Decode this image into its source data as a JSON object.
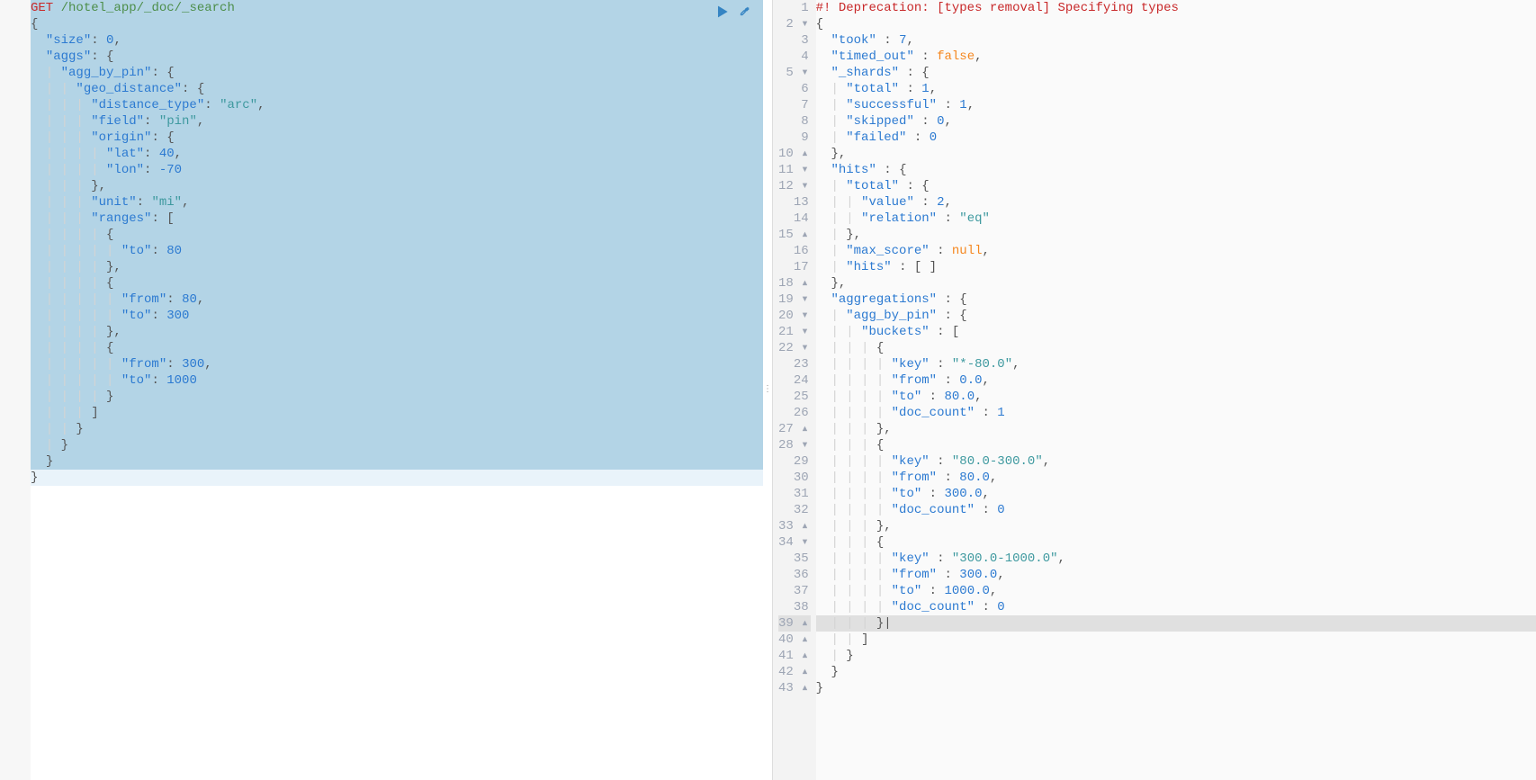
{
  "request": {
    "method": "GET",
    "path": "/hotel_app/_doc/_search",
    "body": {
      "size": 0,
      "aggs": {
        "agg_by_pin": {
          "geo_distance": {
            "distance_type": "arc",
            "field": "pin",
            "origin": {
              "lat": 40,
              "lon": -70
            },
            "unit": "mi",
            "ranges": [
              {
                "to": 80
              },
              {
                "from": 80,
                "to": 300
              },
              {
                "from": 300,
                "to": 1000
              }
            ]
          }
        }
      }
    }
  },
  "response": {
    "warning": "#! Deprecation: [types removal] Specifying types",
    "body": {
      "took": 7,
      "timed_out": false,
      "_shards": {
        "total": 1,
        "successful": 1,
        "skipped": 0,
        "failed": 0
      },
      "hits": {
        "total": {
          "value": 2,
          "relation": "eq"
        },
        "max_score": null,
        "hits": []
      },
      "aggregations": {
        "agg_by_pin": {
          "buckets": [
            {
              "key": "*-80.0",
              "from": 0.0,
              "to": 80.0,
              "doc_count": 1
            },
            {
              "key": "80.0-300.0",
              "from": 80.0,
              "to": 300.0,
              "doc_count": 0
            },
            {
              "key": "300.0-1000.0",
              "from": 300.0,
              "to": 1000.0,
              "doc_count": 0
            }
          ]
        }
      }
    }
  },
  "actions": {
    "run_label": "Run request",
    "wrench_label": "Options"
  },
  "resp_line_nums": [
    "1",
    "2 ▾",
    "3",
    "4",
    "5 ▾",
    "6",
    "7",
    "8",
    "9",
    "10 ▴",
    "11 ▾",
    "12 ▾",
    "13",
    "14",
    "15 ▴",
    "16",
    "17",
    "18 ▴",
    "19 ▾",
    "20 ▾",
    "21 ▾",
    "22 ▾",
    "23",
    "24",
    "25",
    "26",
    "27 ▴",
    "28 ▾",
    "29",
    "30",
    "31",
    "32",
    "33 ▴",
    "34 ▾",
    "35",
    "36",
    "37",
    "38",
    "39 ▴",
    "40 ▴",
    "41 ▴",
    "42 ▴",
    "43 ▴"
  ]
}
